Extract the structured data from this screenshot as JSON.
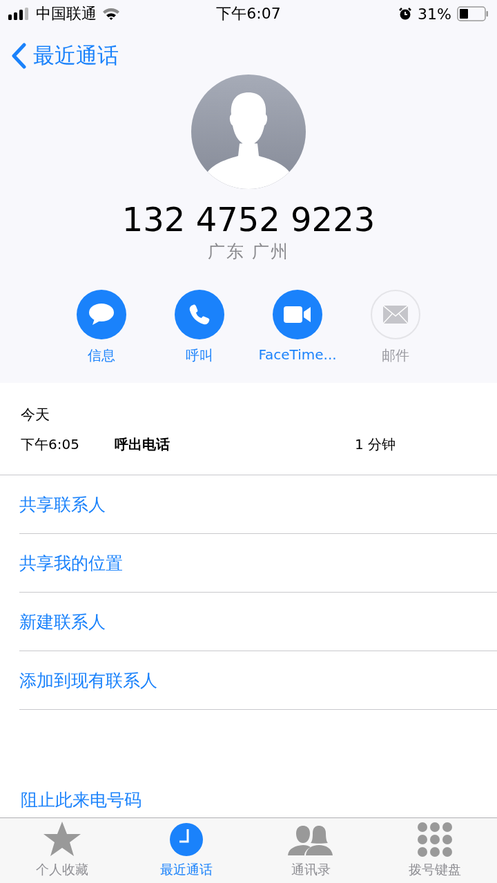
{
  "status_bar": {
    "carrier": "中国联通",
    "time": "下午6:07",
    "battery": "31%"
  },
  "nav": {
    "back": "最近通话"
  },
  "contact": {
    "number": "132 4752 9223",
    "location": "广东 广州"
  },
  "actions": [
    {
      "kind": "message",
      "label": "信息",
      "disabled": false
    },
    {
      "kind": "call",
      "label": "呼叫",
      "disabled": false
    },
    {
      "kind": "video",
      "label": "FaceTime...",
      "disabled": false
    },
    {
      "kind": "mail",
      "label": "邮件",
      "disabled": true
    }
  ],
  "call_log": {
    "date": "今天",
    "entries": [
      {
        "time": "下午6:05",
        "type": "呼出电话",
        "duration": "1 分钟"
      }
    ]
  },
  "options": [
    "共享联系人",
    "共享我的位置",
    "新建联系人",
    "添加到现有联系人"
  ],
  "block": "阻止此来电号码",
  "tabs": [
    {
      "kind": "favorites",
      "label": "个人收藏",
      "selected": false
    },
    {
      "kind": "recents",
      "label": "最近通话",
      "selected": true
    },
    {
      "kind": "contacts",
      "label": "通讯录",
      "selected": false
    },
    {
      "kind": "keypad",
      "label": "拨号键盘",
      "selected": false
    }
  ]
}
